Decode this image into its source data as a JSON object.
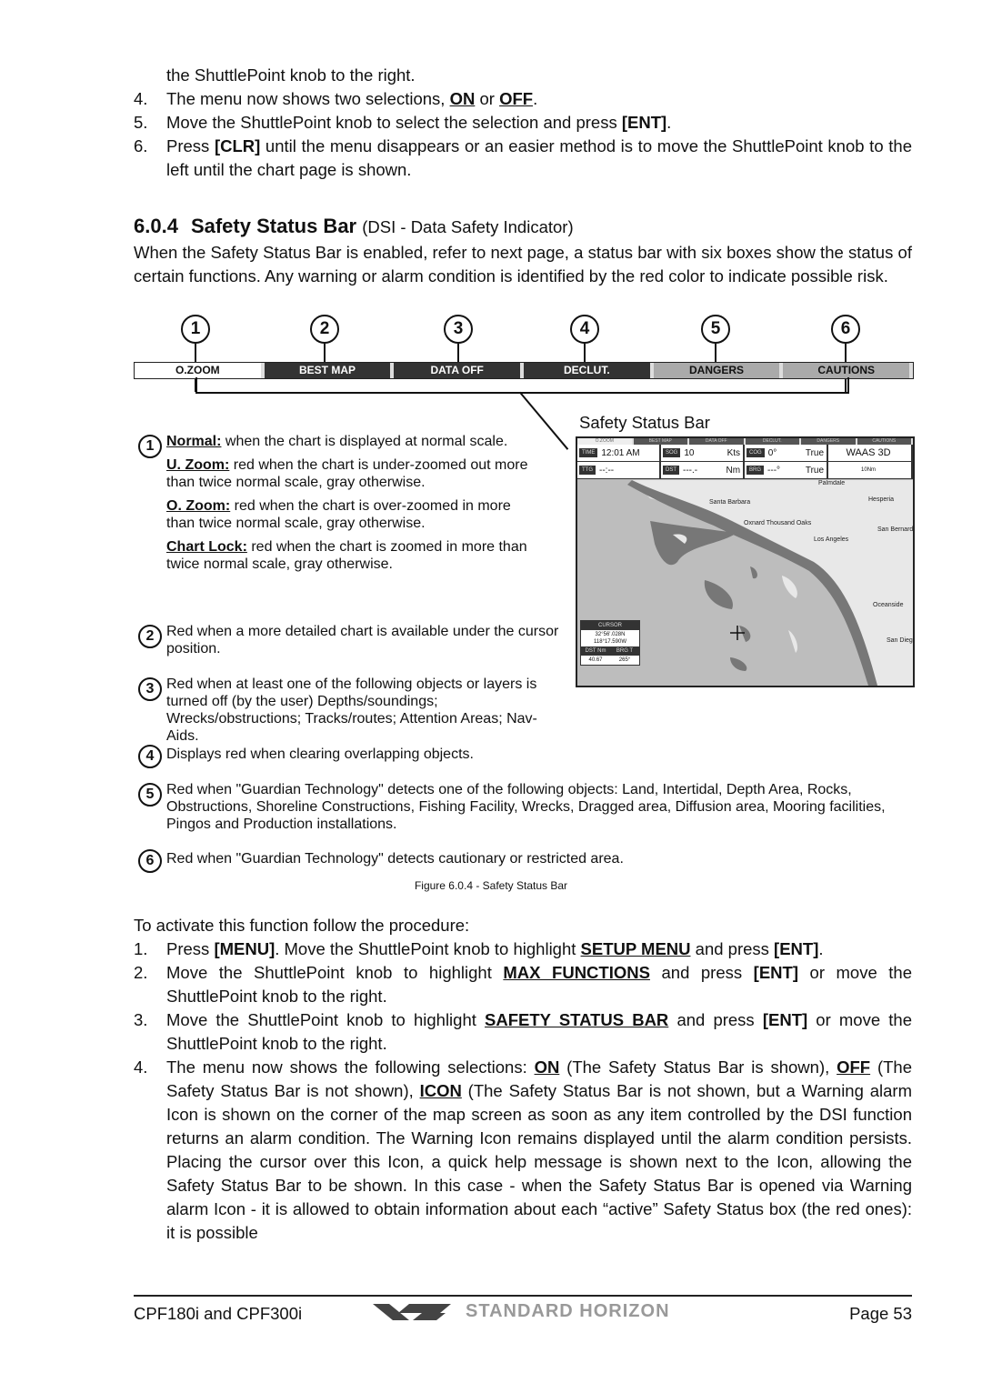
{
  "intro": {
    "cont_line": "the ShuttlePoint knob to the right.",
    "items": [
      {
        "num": "4.",
        "parts": [
          {
            "t": "The menu now shows two selections, "
          },
          {
            "t": "ON",
            "s": "u"
          },
          {
            "t": " or "
          },
          {
            "t": "OFF",
            "s": "u"
          },
          {
            "t": "."
          }
        ]
      },
      {
        "num": "5.",
        "parts": [
          {
            "t": "Move the ShuttlePoint knob to select the selection and press "
          },
          {
            "t": "[ENT]",
            "s": "b"
          },
          {
            "t": "."
          }
        ]
      },
      {
        "num": "6.",
        "parts": [
          {
            "t": "Press "
          },
          {
            "t": "[CLR]",
            "s": "b"
          },
          {
            "t": " until the menu disappears or an easier method is to move the ShuttlePoint knob to the left until the chart page is shown."
          }
        ]
      }
    ]
  },
  "section": {
    "number": "6.0.4",
    "title": "Safety Status Bar",
    "subtitle": "(DSI - Data Safety Indicator)",
    "intro": "When the Safety Status Bar is enabled, refer to next page, a status bar with six boxes show the status of certain functions. Any warning or alarm condition is identified by the red color to indicate possible risk."
  },
  "status_bar": {
    "boxes": [
      {
        "num": "1",
        "label": "O.ZOOM",
        "state": "white"
      },
      {
        "num": "2",
        "label": "BEST MAP",
        "state": "dark"
      },
      {
        "num": "3",
        "label": "DATA OFF",
        "state": "dark"
      },
      {
        "num": "4",
        "label": "DECLUT.",
        "state": "dark"
      },
      {
        "num": "5",
        "label": "DANGERS",
        "state": "light"
      },
      {
        "num": "6",
        "label": "CAUTIONS",
        "state": "light"
      }
    ],
    "caption": "Safety Status Bar"
  },
  "screen": {
    "mini_bar": [
      "O.ZOOM",
      "BEST MAP",
      "DATA OFF",
      "DECLUT.",
      "DANGERS",
      "CAUTIONS"
    ],
    "row1": [
      {
        "label": "TIME",
        "value": "12:01 AM",
        "unit": ""
      },
      {
        "label": "SOG",
        "value": "10",
        "unit": "Kts"
      },
      {
        "label": "COG",
        "value": "0°",
        "unit": "True"
      },
      {
        "label": "",
        "value": "WAAS 3D",
        "unit": ""
      }
    ],
    "row2": [
      {
        "label": "TTG",
        "value": "--:--",
        "unit": ""
      },
      {
        "label": "DST",
        "value": "---.-",
        "unit": "Nm"
      },
      {
        "label": "BRG",
        "value": "---°",
        "unit": "True"
      },
      {
        "label": "",
        "value": "10Nm",
        "unit": ""
      }
    ],
    "map_labels": [
      "Santa Barbara",
      "Oxnard",
      "Thousand Oaks",
      "Los Angeles",
      "San Bernardino",
      "Hesperia",
      "Palmdale",
      "Oceanside",
      "San Diego"
    ],
    "cursor": {
      "header": "CURSOR",
      "lat": "32°56'.028N",
      "lon": "118°17.590W",
      "dst_label": "DST Nm",
      "brg_label": "BRG T",
      "dst_value": "40.67",
      "brg_value": "265°"
    }
  },
  "legend": {
    "item1": [
      {
        "term": "Normal:",
        "text": " when the chart is displayed at normal scale."
      },
      {
        "term": "U. Zoom:",
        "text": " red when the chart is under-zoomed out more than twice normal scale, gray otherwise."
      },
      {
        "term": "O. Zoom:",
        "text": " red when the chart is over-zoomed in more than twice normal scale, gray otherwise."
      },
      {
        "term": "Chart Lock:",
        "text": " red when the chart is zoomed in more than twice normal scale, gray otherwise."
      }
    ],
    "item2": "Red when a more detailed chart is available under the cursor position.",
    "item3": "Red when at least one of the following objects or layers is turned off (by the user) Depths/soundings; Wrecks/obstructions; Tracks/routes; Attention Areas; Nav-Aids.",
    "item4": "Displays red when clearing overlapping objects.",
    "item5": "Red when \"Guardian Technology\" detects one of the following objects: Land, Intertidal, Depth Area, Rocks, Obstructions, Shoreline Constructions, Fishing Facility, Wrecks, Dragged area, Diffusion area, Mooring facilities, Pingos and Production installations.",
    "item6": "Red when \"Guardian Technology\" detects cautionary or restricted area.",
    "nums": [
      "1",
      "2",
      "3",
      "4",
      "5",
      "6"
    ]
  },
  "figure_caption": "Figure 6.0.4 - Safety Status Bar",
  "procedure": {
    "lead": "To activate this function follow the procedure:",
    "items": [
      {
        "num": "1.",
        "parts": [
          {
            "t": "Press "
          },
          {
            "t": "[MENU]",
            "s": "b"
          },
          {
            "t": ". Move the ShuttlePoint knob to highlight "
          },
          {
            "t": "SETUP MENU",
            "s": "u"
          },
          {
            "t": " and press "
          },
          {
            "t": "[ENT]",
            "s": "b"
          },
          {
            "t": "."
          }
        ]
      },
      {
        "num": "2.",
        "parts": [
          {
            "t": "Move the ShuttlePoint knob to highlight "
          },
          {
            "t": "MAX FUNCTIONS",
            "s": "u"
          },
          {
            "t": " and press "
          },
          {
            "t": "[ENT]",
            "s": "b"
          },
          {
            "t": " or move the ShuttlePoint knob to the right."
          }
        ]
      },
      {
        "num": "3.",
        "parts": [
          {
            "t": "Move the ShuttlePoint knob to highlight  "
          },
          {
            "t": "SAFETY STATUS BAR",
            "s": "u"
          },
          {
            "t": " and press "
          },
          {
            "t": "[ENT]",
            "s": "b"
          },
          {
            "t": " or move the ShuttlePoint knob to the right."
          }
        ]
      },
      {
        "num": "4.",
        "parts": [
          {
            "t": "The menu now shows the following selections: "
          },
          {
            "t": "ON",
            "s": "u"
          },
          {
            "t": " (The Safety Status Bar is shown), "
          },
          {
            "t": "OFF",
            "s": "u"
          },
          {
            "t": " (The Safety Status Bar is not shown), "
          },
          {
            "t": "ICON",
            "s": "u"
          },
          {
            "t": " (The Safety Status Bar is not shown, but a Warning alarm Icon is shown on the corner of the map screen as soon as any item controlled by the DSI function returns an alarm condition. The Warning Icon remains displayed until the alarm condition persists. Placing the cursor over this Icon, a quick help message is shown next to the Icon, allowing the Safety Status Bar to be shown. In this case - when the Safety Status Bar is opened via Warning alarm Icon - it is allowed to obtain information about each “active” Safety Status box (the red ones): it is possible"
          }
        ]
      }
    ]
  },
  "footer": {
    "model": "CPF180i and CPF300i",
    "brand": "STANDARD HORIZON",
    "page": "Page 53"
  }
}
